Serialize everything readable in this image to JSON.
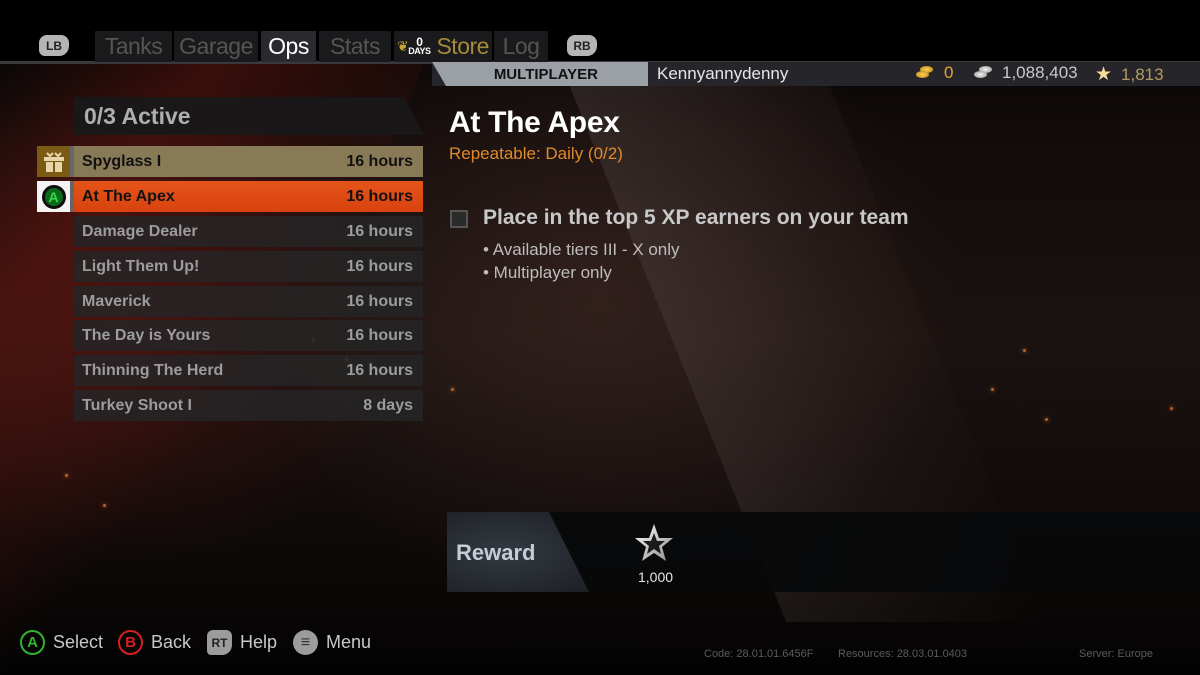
{
  "nav": {
    "left_bumper": "LB",
    "right_bumper": "RB",
    "tabs": [
      {
        "label": "Tanks",
        "active": false
      },
      {
        "label": "Garage",
        "active": false
      },
      {
        "label": "Ops",
        "active": true
      },
      {
        "label": "Stats",
        "active": false
      },
      {
        "label": "Store",
        "active": false,
        "badge_number": "0",
        "badge_text": "DAYS"
      },
      {
        "label": "Log",
        "active": false
      }
    ]
  },
  "player": {
    "mode": "MULTIPLAYER",
    "username": "Kennyannydenny",
    "gold": "0",
    "credits": "1,088,403",
    "free_xp": "1,813"
  },
  "ops_list": {
    "header": "0/3 Active",
    "items": [
      {
        "name": "Spyglass I",
        "time": "16 hours",
        "state": "gift"
      },
      {
        "name": "At The Apex",
        "time": "16 hours",
        "state": "selected"
      },
      {
        "name": "Damage Dealer",
        "time": "16 hours",
        "state": "normal"
      },
      {
        "name": "Light Them Up!",
        "time": "16 hours",
        "state": "normal"
      },
      {
        "name": "Maverick",
        "time": "16 hours",
        "state": "normal"
      },
      {
        "name": "The Day is Yours",
        "time": "16 hours",
        "state": "normal"
      },
      {
        "name": "Thinning The Herd",
        "time": "16 hours",
        "state": "normal"
      },
      {
        "name": "Turkey Shoot I",
        "time": "8 days",
        "state": "normal"
      }
    ]
  },
  "detail": {
    "title": "At The Apex",
    "subtitle": "Repeatable: Daily (0/2)",
    "objective": "Place in the top 5 XP earners on your team",
    "objective_complete": false,
    "conditions": [
      "• Available tiers III - X only",
      "• Multiplayer only"
    ]
  },
  "reward": {
    "label": "Reward",
    "icon": "xp-star-icon",
    "value": "1,000"
  },
  "footer": {
    "hints": [
      {
        "button": "A",
        "label": "Select"
      },
      {
        "button": "B",
        "label": "Back"
      },
      {
        "button": "RT",
        "label": "Help"
      },
      {
        "button": "≡",
        "label": "Menu"
      }
    ],
    "code": "Code: 28.01.01.6456F",
    "resources": "Resources: 28.03.01.0403",
    "server": "Server:  Europe"
  },
  "colors": {
    "accent_orange": "#e04e14",
    "gift_tan": "#887a56",
    "subtitle_orange": "#e08a2a",
    "store_gold": "#a58a3c"
  }
}
